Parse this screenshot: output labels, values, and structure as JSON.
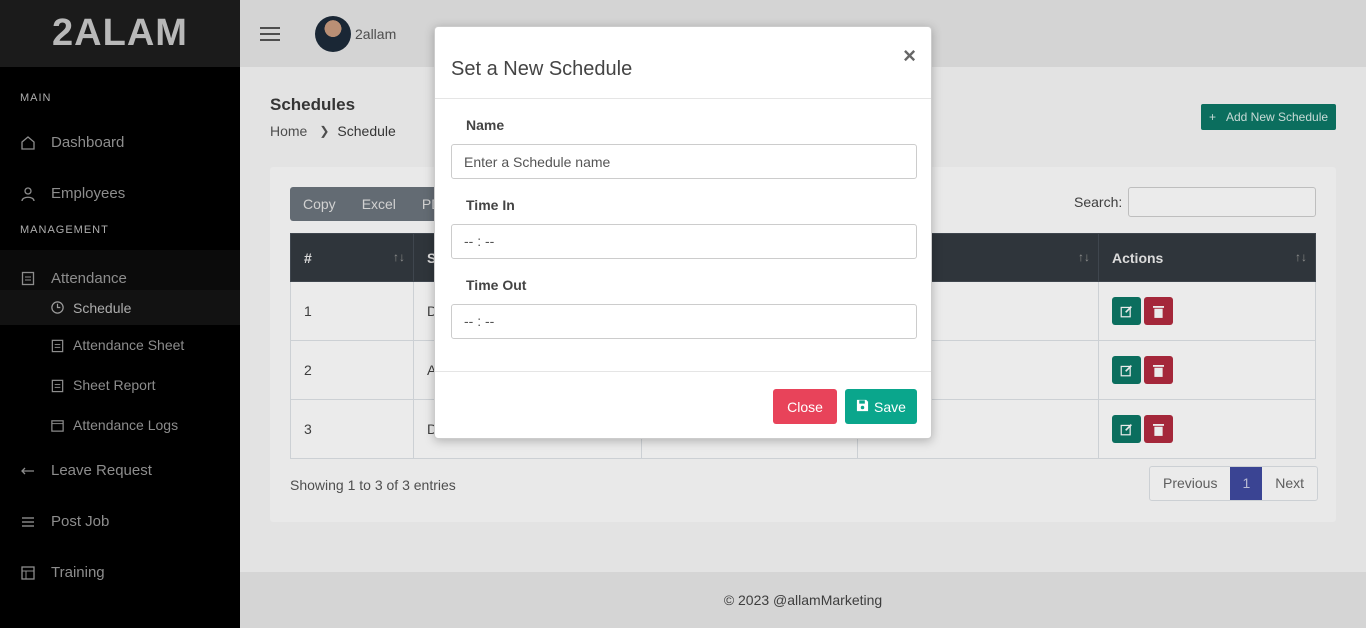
{
  "app": {
    "logo": "2ALAM"
  },
  "sidebar": {
    "section_main": "MAIN",
    "section_management": "MANAGEMENT",
    "items": [
      {
        "label": "Dashboard",
        "icon": "home-icon"
      },
      {
        "label": "Employees",
        "icon": "user-icon"
      },
      {
        "label": "Attendance",
        "icon": "clipboard-icon"
      },
      {
        "label": "Leave Request",
        "icon": "arrow-left-icon"
      },
      {
        "label": "Post Job",
        "icon": "list-icon"
      },
      {
        "label": "Training",
        "icon": "layout-icon"
      }
    ],
    "subitems": [
      {
        "label": "Schedule",
        "icon": "clock-icon"
      },
      {
        "label": "Attendance Sheet",
        "icon": "clipboard-icon"
      },
      {
        "label": "Sheet Report",
        "icon": "clipboard-icon"
      },
      {
        "label": "Attendance Logs",
        "icon": "calendar-icon"
      }
    ]
  },
  "topbar": {
    "username": "2allam"
  },
  "page": {
    "title": "Schedules",
    "breadcrumb": {
      "home": "Home",
      "current": "Schedule"
    },
    "add_button": "Add New Schedule"
  },
  "table": {
    "export_buttons": [
      "Copy",
      "Excel",
      "PD"
    ],
    "search_label": "Search:",
    "headers": [
      "#",
      "S",
      "",
      "",
      "Actions"
    ],
    "rows": [
      {
        "num": "1",
        "col2": "D"
      },
      {
        "num": "2",
        "col2": "A"
      },
      {
        "num": "3",
        "col2": "D"
      }
    ],
    "info": "Showing 1 to 3 of 3 entries",
    "pagination": {
      "previous": "Previous",
      "current": "1",
      "next": "Next"
    }
  },
  "footer": {
    "text": "© 2023 @allamMarketing"
  },
  "modal": {
    "title": "Set a New Schedule",
    "close_symbol": "×",
    "fields": {
      "name_label": "Name",
      "name_placeholder": "Enter a Schedule name",
      "time_in_label": "Time In",
      "time_in_value": "-- : --",
      "time_out_label": "Time Out",
      "time_out_value": "-- : --"
    },
    "close_button": "Close",
    "save_button": "Save"
  },
  "colors": {
    "accent_teal": "#0d7866",
    "save_button": "#0aa68c",
    "close_button": "#e8435a",
    "delete_button": "#b22b3f",
    "pagination_active": "#3f4aa0"
  }
}
